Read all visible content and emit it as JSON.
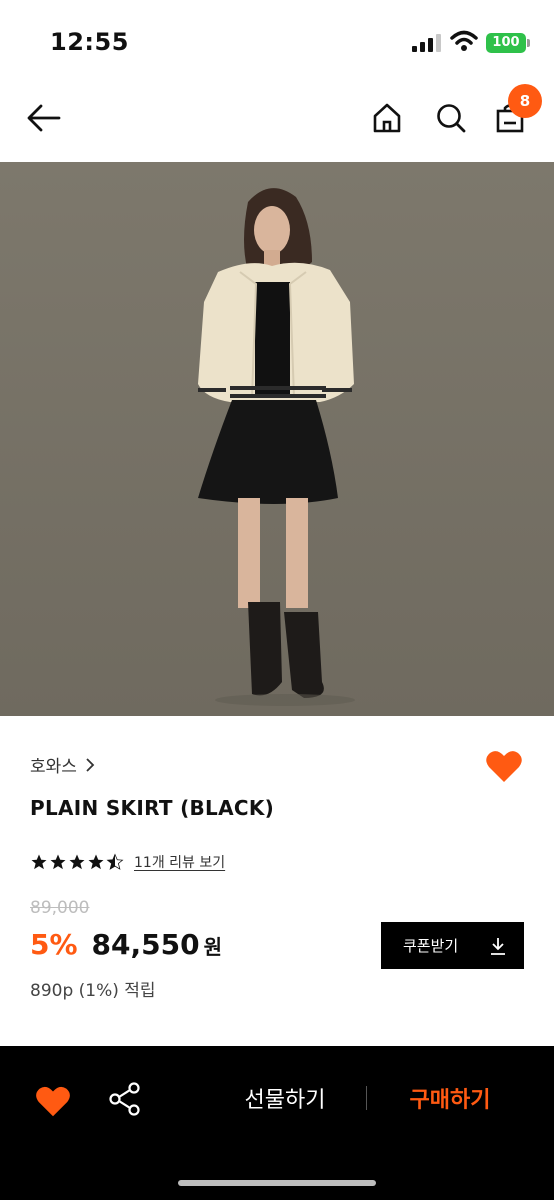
{
  "status": {
    "time": "12:55",
    "battery": "100"
  },
  "nav": {
    "cart_count": "8"
  },
  "product": {
    "brand": "호와스",
    "title": "PLAIN SKIRT (BLACK)",
    "rating_stars": 4.5,
    "review_link": "11개 리뷰 보기",
    "original_price": "89,000",
    "discount": "5%",
    "price": "84,550",
    "currency": "원",
    "points": "890p (1%) 적립",
    "coupon_label": "쿠폰받기"
  },
  "bottom_bar": {
    "gift_label": "선물하기",
    "buy_label": "구매하기"
  },
  "colors": {
    "accent": "#ff5a12",
    "battery": "#2fc14a"
  }
}
